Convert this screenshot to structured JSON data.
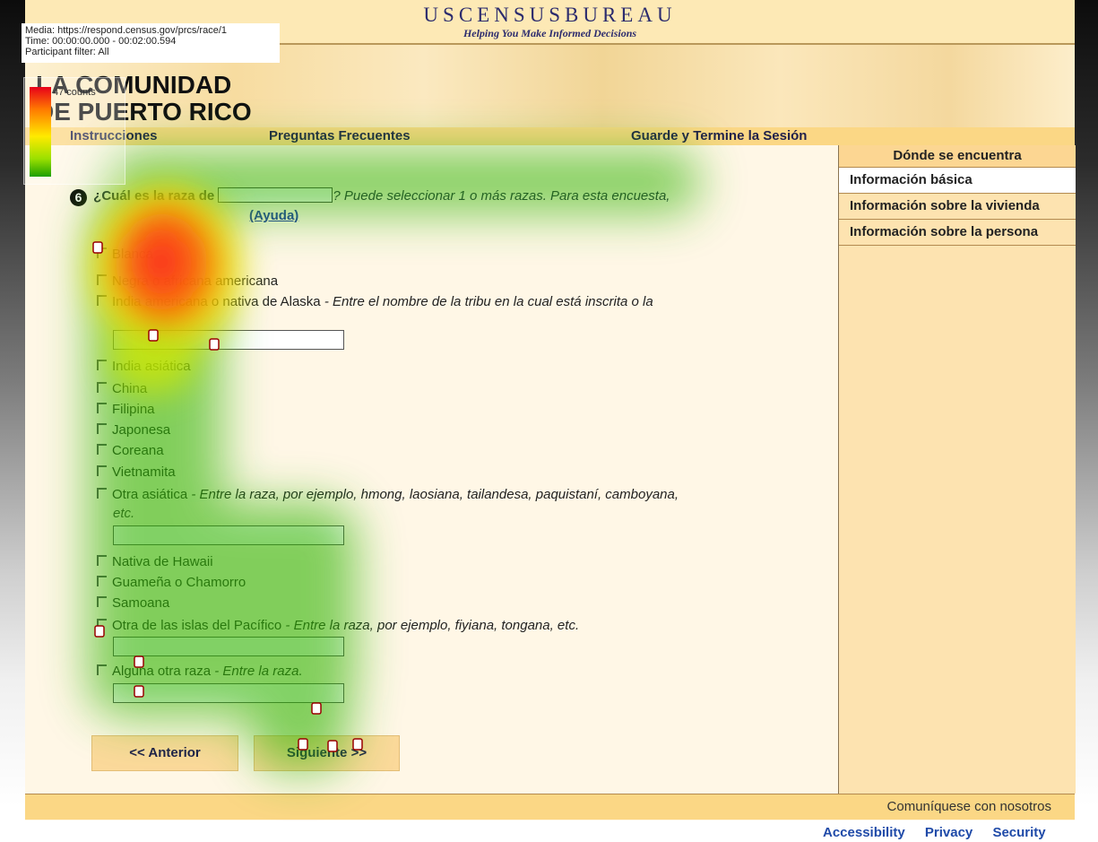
{
  "heatmap_info": {
    "media": "Media: https://respond.census.gov/prcs/race/1",
    "time": "Time: 00:00:00.000 - 00:02:00.594",
    "filter": "Participant filter: All",
    "legend_label": "47 counts"
  },
  "header": {
    "title": "USCENSUSBUREAU",
    "tagline": "Helping You Make Informed Decisions",
    "banner_line1": "LA COMUNIDAD",
    "banner_line2": "DE PUERTO RICO"
  },
  "nav": {
    "instrucciones": "Instrucciones",
    "preguntas": "Preguntas Frecuentes",
    "guarde": "Guarde y Termine la Sesión"
  },
  "sidebar": {
    "title": "Dónde se encuentra",
    "items": [
      {
        "label": "Información básica"
      },
      {
        "label": "Información sobre la vivienda"
      },
      {
        "label": "Información sobre la persona"
      }
    ]
  },
  "question": {
    "number": "6",
    "lead": "¿Cuál es la raza de",
    "hint": "? Puede seleccionar 1 o más razas. Para esta encuesta,",
    "help": "(Ayuda)"
  },
  "options": [
    {
      "label": "Blanca",
      "note": ""
    },
    {
      "label": "Negra o africana americana",
      "note": ""
    },
    {
      "label": "India americana o nativa de Alaska",
      "note": " - Entre el nombre de la tribu en la cual está inscrita o la"
    },
    {
      "label": "India asiática",
      "note": ""
    },
    {
      "label": "China",
      "note": ""
    },
    {
      "label": "Filipina",
      "note": ""
    },
    {
      "label": "Japonesa",
      "note": ""
    },
    {
      "label": "Coreana",
      "note": ""
    },
    {
      "label": "Vietnamita",
      "note": ""
    },
    {
      "label": "Otra asiática",
      "note": " - Entre la raza, por ejemplo, hmong, laosiana, tailandesa, paquistaní, camboyana,"
    },
    {
      "label": "Nativa de Hawaii",
      "note": ""
    },
    {
      "label": "Guameña o Chamorro",
      "note": ""
    },
    {
      "label": "Samoana",
      "note": ""
    },
    {
      "label": "Otra de las islas del Pacífico",
      "note": " - Entre la raza, por ejemplo, fiyiana, tongana, etc."
    },
    {
      "label": "Alguna otra raza",
      "note": " - Entre la raza."
    }
  ],
  "wraps": {
    "otra_asiatica": "etc."
  },
  "buttons": {
    "anterior": "<<  Anterior",
    "siguiente": "Siguiente >>"
  },
  "footer": {
    "contact": "Comuníquese con nosotros",
    "links": [
      "Accessibility",
      "Privacy",
      "Security"
    ]
  },
  "colors": {
    "page_bg": "#fff7e6",
    "nav_bg": "#fbd785",
    "sidebar_bg": "#fde3b0",
    "button_bg": "#fbd99a",
    "link_blue": "#1f4aa8"
  }
}
